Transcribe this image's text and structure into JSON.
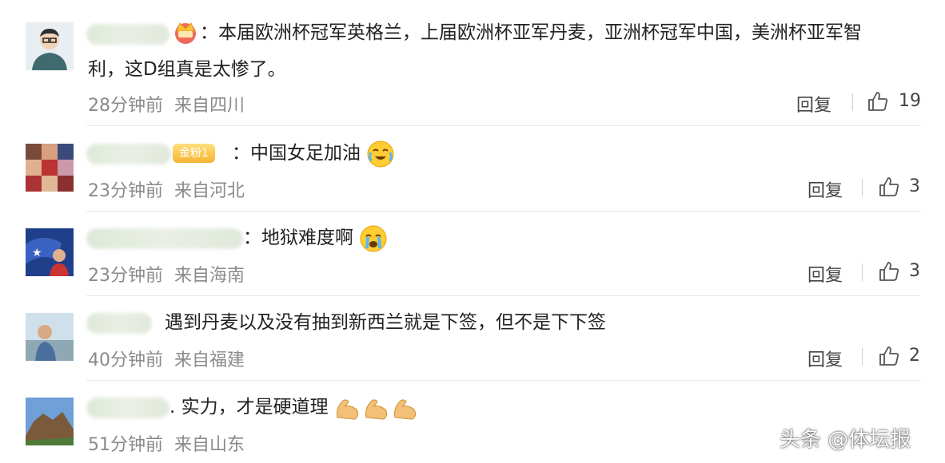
{
  "comments": [
    {
      "text_line1": "：本届欧洲杯冠军英格兰，上届欧洲杯亚军丹麦，亚洲杯冠军中国，美洲杯亚军智",
      "text_line2": "利，这D组真是太惨了。",
      "time": "28分钟前",
      "location": "来自四川",
      "reply": "回复",
      "likes": "19",
      "avatar_icon": "avatar-cartoon-man"
    },
    {
      "badge": "金粉1",
      "text": "：中国女足加油",
      "emoji": "cry-laugh-emoji",
      "time": "23分钟前",
      "location": "来自河北",
      "reply": "回复",
      "likes": "3",
      "avatar_icon": "avatar-team-photo-grid"
    },
    {
      "text": "：地狱难度啊",
      "emoji": "crying-emoji",
      "time": "23分钟前",
      "location": "来自海南",
      "reply": "回复",
      "likes": "3",
      "avatar_icon": "avatar-sports-player"
    },
    {
      "text": "遇到丹麦以及没有抽到新西兰就是下签，但不是下下签",
      "time": "40分钟前",
      "location": "来自福建",
      "reply": "回复",
      "likes": "2",
      "avatar_icon": "avatar-man-landscape"
    },
    {
      "text": ". 实力，才是硬道理",
      "emoji": "flexed-biceps-emoji",
      "time": "51分钟前",
      "location": "来自山东",
      "avatar_icon": "avatar-great-wall"
    }
  ],
  "watermark": "头条 @体坛报",
  "colors": {
    "text": "#222222",
    "meta": "#8a8a8a",
    "divider": "#e8e8e8",
    "badge": "#f5b431"
  }
}
